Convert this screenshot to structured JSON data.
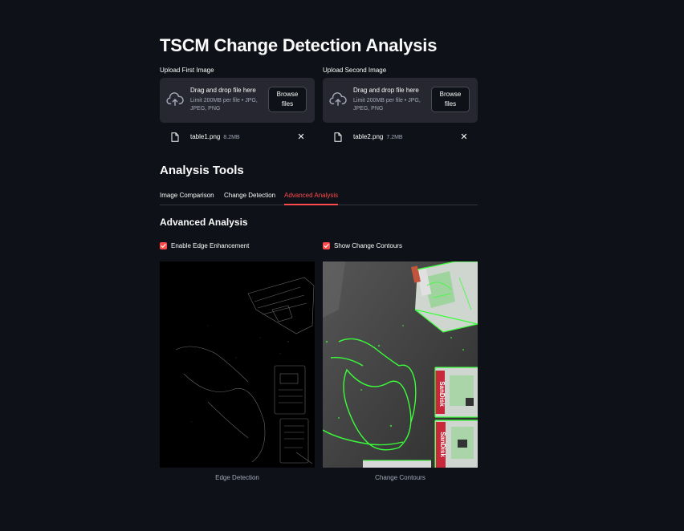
{
  "page": {
    "title": "TSCM Change Detection Analysis"
  },
  "uploads": [
    {
      "label": "Upload First Image",
      "drop_text": "Drag and drop file here",
      "limit_text": "Limit 200MB per file • JPG, JPEG, PNG",
      "browse_label": "Browse files",
      "file": {
        "name": "table1.png",
        "size": "8.2MB"
      },
      "remove_symbol": "✕"
    },
    {
      "label": "Upload Second Image",
      "drop_text": "Drag and drop file here",
      "limit_text": "Limit 200MB per file • JPG, JPEG, PNG",
      "browse_label": "Browse files",
      "file": {
        "name": "table2.png",
        "size": "7.2MB"
      },
      "remove_symbol": "✕"
    }
  ],
  "analysis": {
    "title": "Analysis Tools",
    "tabs": [
      {
        "label": "Image Comparison",
        "active": false
      },
      {
        "label": "Change Detection",
        "active": false
      },
      {
        "label": "Advanced Analysis",
        "active": true
      }
    ],
    "active_section": {
      "title": "Advanced Analysis",
      "options": [
        {
          "label": "Enable Edge Enhancement",
          "checked": true
        },
        {
          "label": "Show Change Contours",
          "checked": true
        }
      ],
      "images": [
        {
          "caption": "Edge Detection"
        },
        {
          "caption": "Change Contours",
          "product_label": "SanDisk"
        }
      ]
    }
  },
  "colors": {
    "background": "#0e1117",
    "panel": "#262730",
    "accent": "#ff4b4b",
    "contour": "#39ff39"
  },
  "icons": {
    "upload": "cloud-upload-icon",
    "file": "file-icon",
    "close": "close-icon",
    "checkbox": "checkmark-icon"
  }
}
